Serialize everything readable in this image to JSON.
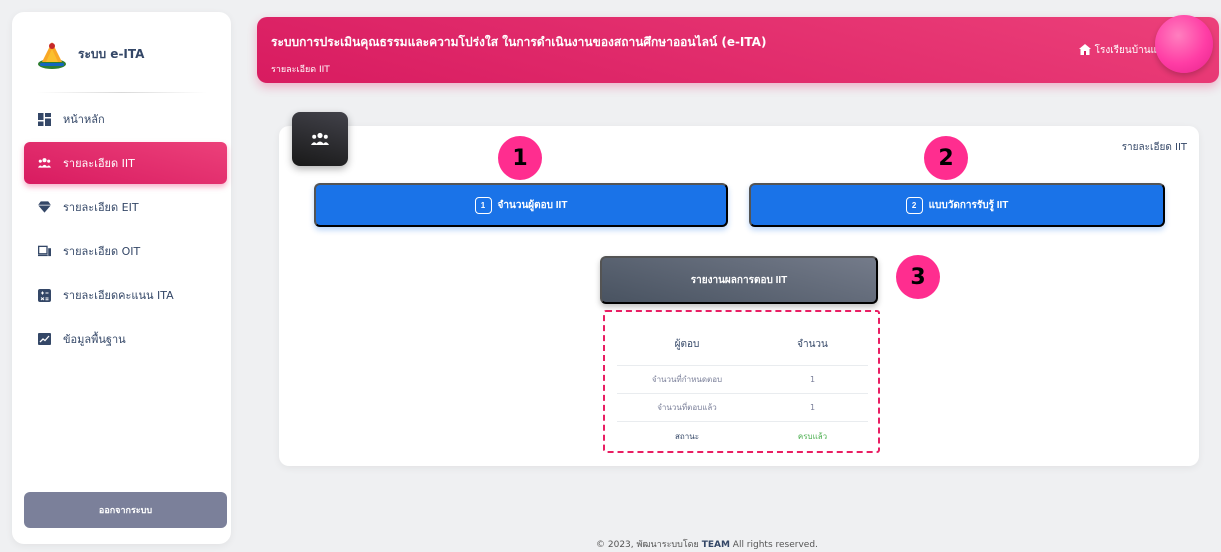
{
  "sidebar": {
    "brand": "ระบบ e-ITA",
    "items": [
      {
        "label": "หน้าหลัก",
        "icon": "dashboard-icon",
        "active": false
      },
      {
        "label": "รายละเอียด IIT",
        "icon": "users-icon",
        "active": true
      },
      {
        "label": "รายละเอียด EIT",
        "icon": "diamond-icon",
        "active": false
      },
      {
        "label": "รายละเอียด OIT",
        "icon": "monitor-icon",
        "active": false
      },
      {
        "label": "รายละเอียดคะแนน ITA",
        "icon": "calculator-icon",
        "active": false
      },
      {
        "label": "ข้อมูลพื้นฐาน",
        "icon": "chart-icon",
        "active": false
      }
    ],
    "logout_label": "ออกจากระบบ"
  },
  "header": {
    "title": "ระบบการประเมินคุณธรรมและความโปร่งใส ในการดำเนินงานของสถานศึกษาออนไลน์ (e-ITA)",
    "breadcrumb": "รายละเอียด IIT",
    "school": "โรงเรียนบ้านแ"
  },
  "card": {
    "label": "รายละเอียด IIT",
    "btn1_num": "1",
    "btn1_label": "จำนวนผู้ตอบ IIT",
    "btn2_num": "2",
    "btn2_label": "แบบวัดการรับรู้ IIT",
    "report_label": "รายงานผลการตอบ IIT"
  },
  "badges": {
    "b1": "1",
    "b2": "2",
    "b3": "3"
  },
  "table": {
    "headers": [
      "ผู้ตอบ",
      "จำนวน"
    ],
    "rows": [
      [
        "จำนวนที่กำหนดตอบ",
        "1"
      ],
      [
        "จำนวนที่ตอบแล้ว",
        "1"
      ],
      [
        "สถานะ",
        "ครบแล้ว"
      ]
    ]
  },
  "footer": {
    "prefix": "© 2023, พัฒนาระบบโดย",
    "team": "TEAM",
    "suffix": "All rights reserved."
  },
  "colors": {
    "accent": "#e91e63",
    "primary_blue": "#1a73e8",
    "status_green": "#4caf50"
  }
}
